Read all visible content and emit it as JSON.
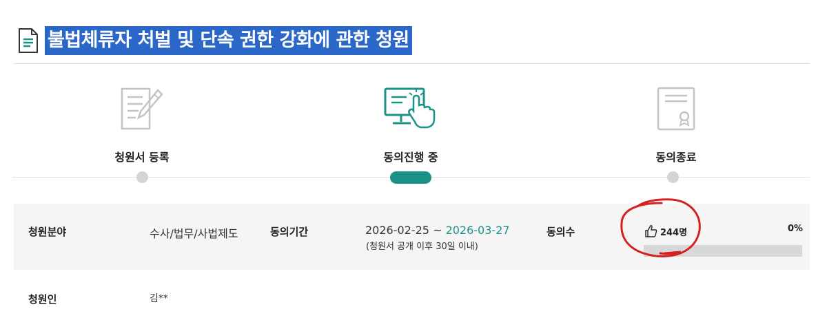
{
  "page": {
    "title": "불법체류자 처벌 및 단속 권한 강화에 관한 청원"
  },
  "steps": [
    {
      "label": "청원서 등록",
      "icon": "document-pen-icon",
      "state": "done"
    },
    {
      "label": "동의진행 중",
      "icon": "monitor-click-icon",
      "state": "active"
    },
    {
      "label": "동의종료",
      "icon": "certificate-icon",
      "state": "pending"
    }
  ],
  "colors": {
    "accent": "#1b9287",
    "title_highlight": "#2b66c9",
    "annotation": "#d42020"
  },
  "info": {
    "field_label": "청원분야",
    "field_value": "수사/법무/사법제도",
    "period_label": "동의기간",
    "period_start": "2026-02-25",
    "period_sep": " ~ ",
    "period_end": "2026-03-27",
    "period_note": "(청원서 공개 이후 30일 이내)",
    "count_label": "동의수",
    "count_value": "244명",
    "count_icon": "thumbs-up-icon",
    "percent_text": "0%",
    "progress_fraction": 0.0,
    "petitioner_label": "청원인",
    "petitioner_value": "김**"
  }
}
